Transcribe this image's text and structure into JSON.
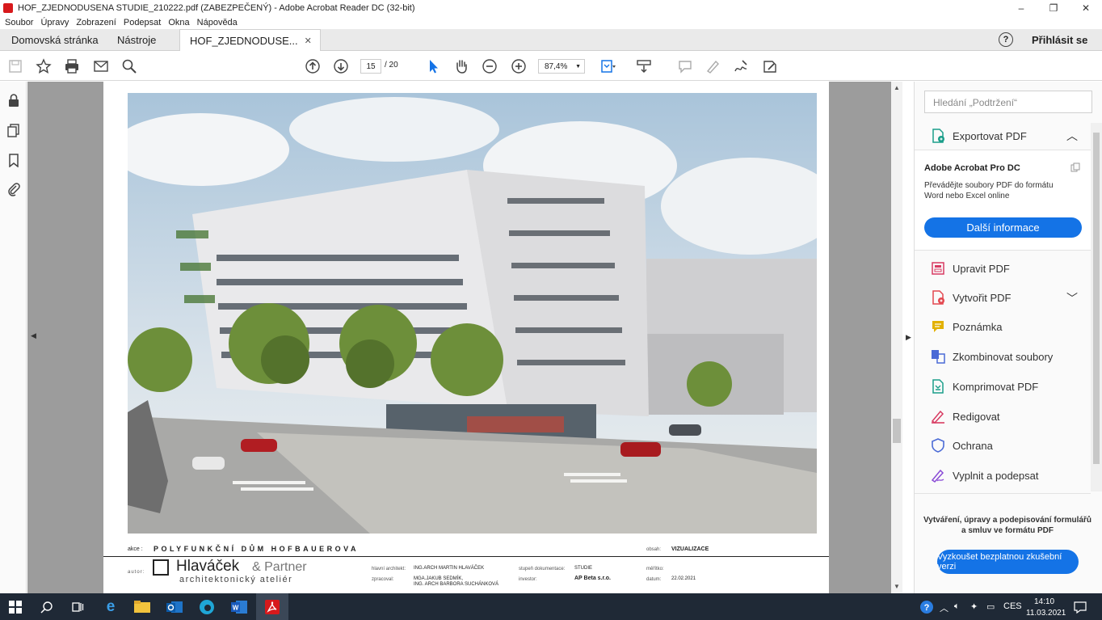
{
  "window": {
    "title": "HOF_ZJEDNODUSENA STUDIE_210222.pdf (ZABEZPEČENÝ) - Adobe Acrobat Reader DC (32-bit)",
    "controls": [
      "–",
      "❐",
      "✕"
    ]
  },
  "menu": [
    "Soubor",
    "Úpravy",
    "Zobrazení",
    "Podepsat",
    "Okna",
    "Nápověda"
  ],
  "tabs": {
    "home": "Domovská stránka",
    "tools": "Nástroje",
    "document": "HOF_ZJEDNODUSE...",
    "close": "✕",
    "help": "?",
    "login": "Přihlásit se"
  },
  "toolbar": {
    "page_current": "15",
    "page_total": "/ 20",
    "zoom": "87,4%",
    "icons": [
      "save-icon",
      "star-icon",
      "print-icon",
      "mail-icon",
      "search-icon",
      "page-up-icon",
      "page-down-icon",
      "select-cursor-icon",
      "hand-icon",
      "zoom-out-icon",
      "zoom-in-icon",
      "fit-page-icon",
      "scroll-mode-icon",
      "comment-icon",
      "highlight-icon",
      "sign-icon",
      "fill-sign-icon"
    ]
  },
  "document": {
    "akce_label": "akce :",
    "akce_value": "POLYFUNKČNÍ DŮM HOFBAUEROVA",
    "obsah_label": "obsah:",
    "obsah_value": "VIZUALIZACE",
    "autor_label": "autor:",
    "firm_name": "Hlaváček",
    "firm_partner": "& Partner",
    "firm_sub": "architektonický ateliér",
    "hlavni_label": "hlavní architekt:",
    "hlavni_value": "ING.ARCH MARTIN HLAVÁČEK",
    "zpracoval_label": "zpracoval:",
    "zpracoval_value1": "MGA.JAKUB SEDMÍK,",
    "zpracoval_value2": "ING. ARCH BARBORA SUCHÁNKOVÁ",
    "stupen_label": "stupeň dokumentace:",
    "stupen_value": "STUDIE",
    "investor_label": "investor:",
    "investor_value": "AP Beta s.r.o.",
    "meritko_label": "měřítko:",
    "meritko_value": "",
    "datum_label": "datum:",
    "datum_value": "22.02.2021"
  },
  "right_panel": {
    "search_placeholder": "Hledání „Podtržení“",
    "export_title": "Exportovat PDF",
    "pro_title": "Adobe Acrobat Pro DC",
    "pro_desc1": "Převádějte soubory PDF do formátu",
    "pro_desc2": "Word nebo Excel online",
    "more_button": "Další informace",
    "tools": [
      {
        "label": "Upravit PDF",
        "icon": "edit-pdf-icon",
        "color": "#d83b62"
      },
      {
        "label": "Vytvořit PDF",
        "icon": "create-pdf-icon",
        "color": "#e34850"
      },
      {
        "label": "Poznámka",
        "icon": "comment-icon",
        "color": "#e2b100"
      },
      {
        "label": "Zkombinovat soubory",
        "icon": "combine-files-icon",
        "color": "#4b6bd6"
      },
      {
        "label": "Komprimovat PDF",
        "icon": "compress-pdf-icon",
        "color": "#1b9e8a"
      },
      {
        "label": "Redigovat",
        "icon": "redact-icon",
        "color": "#d83b62"
      },
      {
        "label": "Ochrana",
        "icon": "protect-icon",
        "color": "#4b6bd6"
      },
      {
        "label": "Vyplnit a podepsat",
        "icon": "fill-sign-icon",
        "color": "#8a4bd6"
      }
    ],
    "promo_line1": "Vytváření, úpravy a podepisování formulářů",
    "promo_line2": "a smluv ve formátu PDF",
    "try_button": "Vyzkoušet bezplatnou zkušební verzi"
  },
  "taskbar": {
    "lang": "CES",
    "time": "14:10",
    "date": "11.03.2021"
  },
  "colors": {
    "accent": "#1473e6",
    "taskbar": "#1f2936",
    "doc_background": "#9c9c9c"
  }
}
